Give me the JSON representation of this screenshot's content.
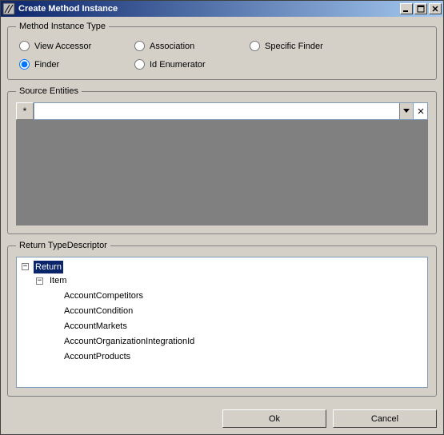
{
  "window": {
    "title": "Create Method Instance"
  },
  "groups": {
    "method_instance_type": "Method Instance Type",
    "source_entities": "Source Entities",
    "return_type_descriptor": "Return TypeDescriptor"
  },
  "radios": {
    "view_accessor": "View Accessor",
    "association": "Association",
    "specific_finder": "Specific Finder",
    "finder": "Finder",
    "id_enumerator": "Id Enumerator",
    "selected": "finder"
  },
  "source": {
    "new_row_marker": "*",
    "value": ""
  },
  "tree": {
    "root": {
      "label": "Return",
      "expanded": true,
      "children": [
        {
          "label": "Item",
          "expanded": true,
          "children": [
            {
              "label": "AccountCompetitors"
            },
            {
              "label": "AccountCondition"
            },
            {
              "label": "AccountMarkets"
            },
            {
              "label": "AccountOrganizationIntegrationId"
            },
            {
              "label": "AccountProducts"
            }
          ]
        }
      ]
    },
    "selected": "Return"
  },
  "buttons": {
    "ok": "Ok",
    "cancel": "Cancel"
  },
  "glyphs": {
    "minus": "−"
  }
}
